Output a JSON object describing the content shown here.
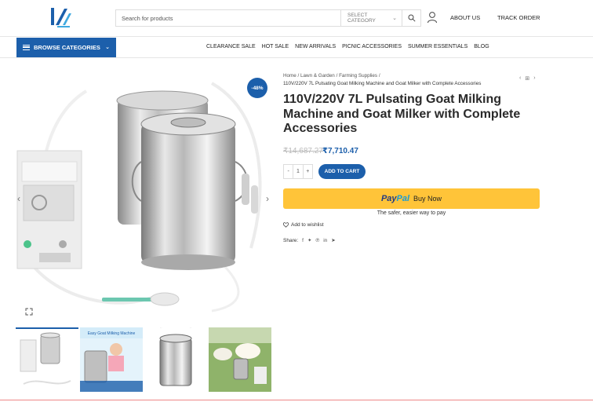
{
  "header": {
    "search_placeholder": "Search for products",
    "category_label": "SELECT CATEGORY",
    "about": "ABOUT US",
    "track": "TRACK ORDER"
  },
  "nav": {
    "browse": "BROWSE CATEGORIES",
    "links": [
      "CLEARANCE SALE",
      "HOT SALE",
      "NEW ARRIVALS",
      "PICNIC ACCESSORIES",
      "SUMMER ESSENTIALS",
      "BLOG"
    ]
  },
  "gallery": {
    "discount": "-48%",
    "thumb2_text": "Easy Goat Milking Machine"
  },
  "breadcrumb": {
    "home": "Home",
    "cat1": "Lawn & Garden",
    "cat2": "Farming Supplies",
    "current": "110V/220V 7L Pulsating Goat Milking Machine and Goat Milker with Complete Accessories"
  },
  "product": {
    "title": "110V/220V 7L Pulsating Goat Milking Machine and Goat Milker with Complete Accessories",
    "price_old": "₹14,687.27",
    "price_new": "₹7,710.47",
    "qty": "1",
    "add_to_cart": "ADD TO CART",
    "paypal_word1": "Pay",
    "paypal_word2": "Pal",
    "paypal_button": "Buy Now",
    "paypal_tagline": "The safer, easier way to pay",
    "wishlist": "Add to wishlist",
    "share": "Share:"
  },
  "colors": {
    "brand": "#1c5fab",
    "paypal": "#ffc439"
  },
  "icons": [
    "search-icon",
    "user-icon",
    "heart-icon",
    "facebook-icon",
    "twitter-icon",
    "pinterest-icon",
    "linkedin-icon",
    "telegram-icon",
    "zoom-icon"
  ]
}
